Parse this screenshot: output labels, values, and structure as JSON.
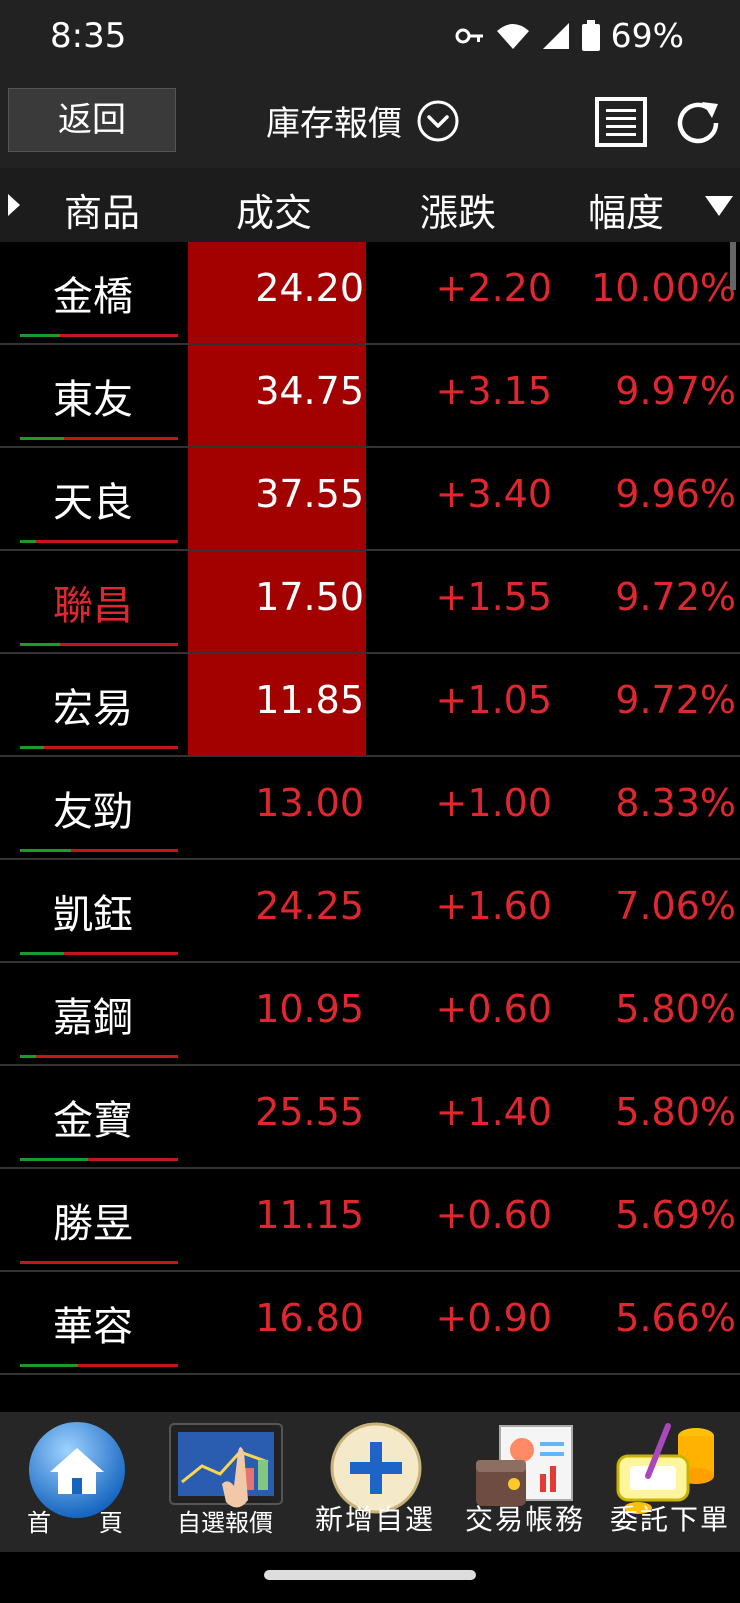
{
  "status_bar": {
    "time": "8:35",
    "battery": "69%",
    "icons": [
      "key-icon",
      "wifi-icon",
      "signal-icon",
      "battery-icon"
    ]
  },
  "header": {
    "back_label": "返回",
    "title": "庫存報價",
    "icons": [
      "chevron-down-circle-icon",
      "list-icon",
      "refresh-icon"
    ]
  },
  "columns": {
    "product": "商品",
    "last": "成交",
    "change": "漲跌",
    "percent": "幅度"
  },
  "rows": [
    {
      "name": "金橋",
      "price": "24.20",
      "change": "+2.20",
      "percent": "10.00%",
      "limit_up": true,
      "name_red": false,
      "bar_green": 0.25
    },
    {
      "name": "東友",
      "price": "34.75",
      "change": "+3.15",
      "percent": "9.97%",
      "limit_up": true,
      "name_red": false,
      "bar_green": 0.28
    },
    {
      "name": "天良",
      "price": "37.55",
      "change": "+3.40",
      "percent": "9.96%",
      "limit_up": true,
      "name_red": false,
      "bar_green": 0.1
    },
    {
      "name": "聯昌",
      "price": "17.50",
      "change": "+1.55",
      "percent": "9.72%",
      "limit_up": true,
      "name_red": true,
      "bar_green": 0.25
    },
    {
      "name": "宏易",
      "price": "11.85",
      "change": "+1.05",
      "percent": "9.72%",
      "limit_up": true,
      "name_red": false,
      "bar_green": 0.15
    },
    {
      "name": "友勁",
      "price": "13.00",
      "change": "+1.00",
      "percent": "8.33%",
      "limit_up": false,
      "name_red": false,
      "bar_green": 0.32
    },
    {
      "name": "凱鈺",
      "price": "24.25",
      "change": "+1.60",
      "percent": "7.06%",
      "limit_up": false,
      "name_red": false,
      "bar_green": 0.28
    },
    {
      "name": "嘉鋼",
      "price": "10.95",
      "change": "+0.60",
      "percent": "5.80%",
      "limit_up": false,
      "name_red": false,
      "bar_green": 0.1
    },
    {
      "name": "金寶",
      "price": "25.55",
      "change": "+1.40",
      "percent": "5.80%",
      "limit_up": false,
      "name_red": false,
      "bar_green": 0.43
    },
    {
      "name": "勝昱",
      "price": "11.15",
      "change": "+0.60",
      "percent": "5.69%",
      "limit_up": false,
      "name_red": false,
      "bar_green": 0.0
    },
    {
      "name": "華容",
      "price": "16.80",
      "change": "+0.90",
      "percent": "5.66%",
      "limit_up": false,
      "name_red": false,
      "bar_green": 0.37
    }
  ],
  "bottom_nav": [
    {
      "label": "首　　頁",
      "icon": "home-icon"
    },
    {
      "label": "自選報價",
      "icon": "watchlist-chart-icon"
    },
    {
      "label": "新增自選",
      "icon": "add-plus-icon"
    },
    {
      "label": "交易帳務",
      "icon": "wallet-report-icon"
    },
    {
      "label": "委託下單",
      "icon": "coins-order-icon"
    }
  ],
  "colors": {
    "up_red": "#e0262e",
    "limit_up_bg": "#a30000",
    "bar_green": "#1a9b2a",
    "bar_red": "#c4161c"
  }
}
